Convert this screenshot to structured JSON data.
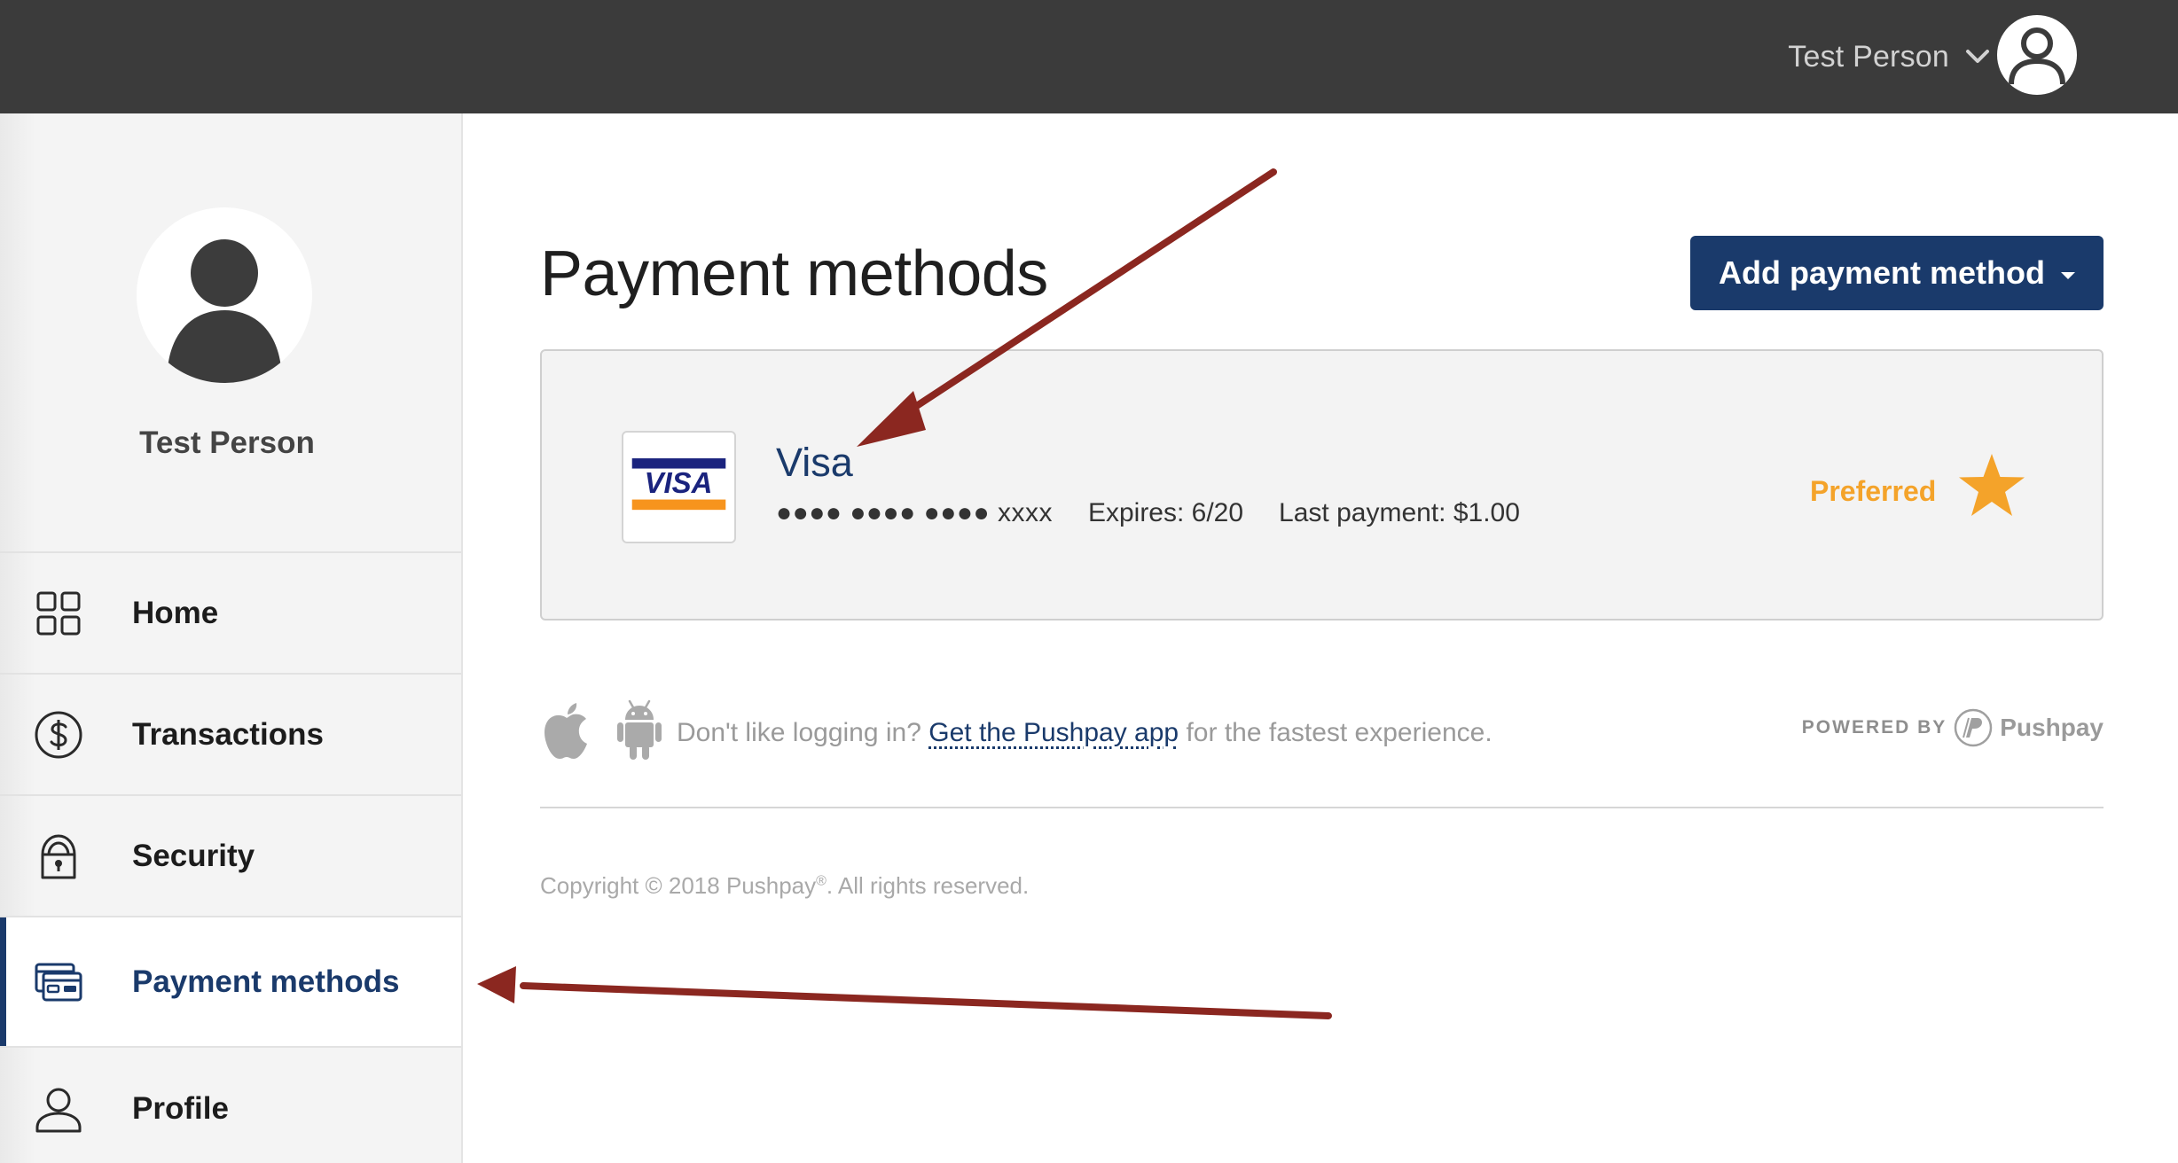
{
  "header": {
    "user_name": "Test Person",
    "icons": {
      "dropdown": "chevron-down-icon",
      "avatar": "user-avatar-icon"
    }
  },
  "sidebar": {
    "profile_name": "Test Person",
    "items": [
      {
        "label": "Home",
        "icon": "grid-icon",
        "active": false
      },
      {
        "label": "Transactions",
        "icon": "dollar-icon",
        "active": false
      },
      {
        "label": "Security",
        "icon": "lock-icon",
        "active": false
      },
      {
        "label": "Payment methods",
        "icon": "credit-card-icon",
        "active": true
      },
      {
        "label": "Profile",
        "icon": "user-icon",
        "active": false
      }
    ]
  },
  "main": {
    "title": "Payment methods",
    "add_button_label": "Add payment method",
    "payment_card": {
      "brand": "Visa",
      "logo_text": "VISA",
      "masked_number": "●●●● ●●●● ●●●● xxxx",
      "expires": "Expires: 6/20",
      "last_payment": "Last payment: $1.00",
      "preferred_label": "Preferred"
    },
    "app_promo": {
      "text_before": "Don't like logging in?",
      "link_text": "Get the Pushpay app",
      "text_after": "for the fastest experience.",
      "powered_by": "POWERED BY",
      "brand": "Pushpay"
    },
    "copyright": {
      "text": "Copyright © 2018 Pushpay",
      "mark": "®",
      "suffix": ". All rights reserved."
    }
  },
  "colors": {
    "topbar": "#3b3b3b",
    "accent": "#1a3a6b",
    "preferred": "#f4a32a",
    "annotation_arrow": "#8b2720"
  }
}
